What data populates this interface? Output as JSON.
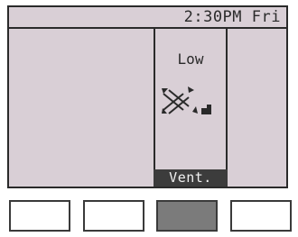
{
  "header": {
    "time": "2:30PM",
    "day": "Fri"
  },
  "main": {
    "fan_speed": "Low",
    "vent_icon": "louver-swing-icon",
    "vent_level_icon": "small-fan-level-icon"
  },
  "footer": {
    "mode_label": "Vent."
  },
  "function_buttons": [
    {
      "name": "F1",
      "state": "off"
    },
    {
      "name": "F2",
      "state": "off"
    },
    {
      "name": "F3",
      "state": "selected"
    },
    {
      "name": "F4",
      "state": "off"
    }
  ],
  "colors": {
    "screen_bg": "#d9cfd6",
    "text": "#2a2a2a",
    "selected_button": "#7b7b7b"
  }
}
